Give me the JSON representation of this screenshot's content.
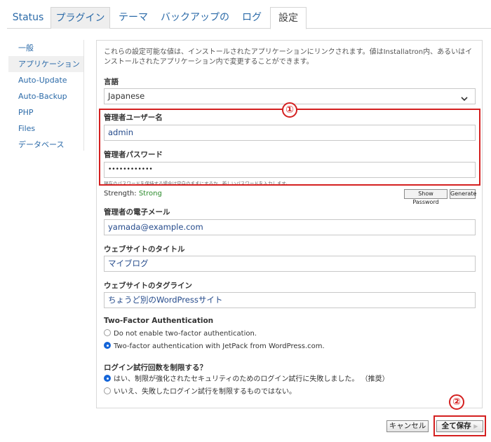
{
  "tabs": [
    {
      "label": "Status"
    },
    {
      "label": "プラグイン"
    },
    {
      "label": "テーマ"
    },
    {
      "label": "バックアップの"
    },
    {
      "label": "ログ"
    },
    {
      "label": "設定"
    }
  ],
  "sidebar": {
    "items": [
      {
        "label": "一般"
      },
      {
        "label": "アプリケーション"
      },
      {
        "label": "Auto-Update"
      },
      {
        "label": "Auto-Backup"
      },
      {
        "label": "PHP"
      },
      {
        "label": "Files"
      },
      {
        "label": "データベース"
      }
    ]
  },
  "intro": "これらの設定可能な値は、インストールされたアプリケーションにリンクされます。値はInstallatron内、あるいはインストールされたアプリケーション内で変更することができます。",
  "language": {
    "label": "言語",
    "value": "Japanese"
  },
  "admin_user": {
    "label": "管理者ユーザー名",
    "value": "admin"
  },
  "admin_password": {
    "label": "管理者パスワード",
    "value": "••••••••••••",
    "hint": "現在のパスワードを保持する場合は空白のままにするか、新しいパスワードを入力します。",
    "strength_label": "Strength:",
    "strength_value": "Strong",
    "show_password": "Show Password",
    "generate": "Generate"
  },
  "admin_email": {
    "label": "管理者の電子メール",
    "value": "yamada@example.com"
  },
  "site_title": {
    "label": "ウェブサイトのタイトル",
    "value": "マイブログ"
  },
  "site_tagline": {
    "label": "ウェブサイトのタグライン",
    "value": "ちょうど別のWordPressサイト"
  },
  "two_factor": {
    "label": "Two-Factor Authentication",
    "options": [
      {
        "label": "Do not enable two-factor authentication.",
        "selected": false
      },
      {
        "label": "Two-factor authentication with JetPack from WordPress.com.",
        "selected": true
      }
    ]
  },
  "login_limit": {
    "label": "ログイン試行回数を制限する？",
    "options": [
      {
        "label": "はい、制限が強化されたセキュリティのためのログイン試行に失敗しました。 （推奨）",
        "selected": true
      },
      {
        "label": "いいえ、失敗したログイン試行を制限するものではない。",
        "selected": false
      }
    ]
  },
  "annotations": {
    "one": "①",
    "two": "②"
  },
  "buttons": {
    "cancel": "キャンセル",
    "save": "全て保存"
  },
  "colors": {
    "accent": "#2b6aa8",
    "highlight": "#d42020",
    "strength": "#2a8a2a"
  }
}
